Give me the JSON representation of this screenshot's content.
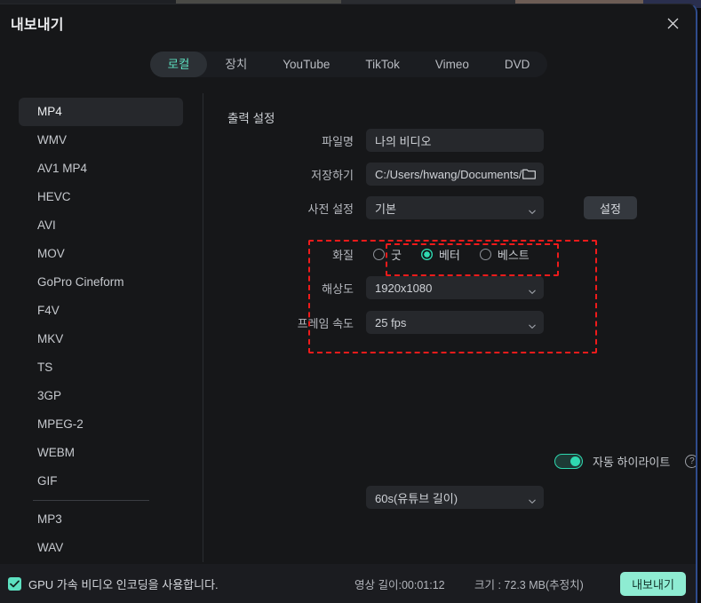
{
  "window": {
    "title": "내보내기",
    "close_icon": "close-icon",
    "accent": "#2fd9b0",
    "highlight_color": "#ef1b1b"
  },
  "tabs": [
    {
      "label": "로컬",
      "active": true
    },
    {
      "label": "장치",
      "active": false
    },
    {
      "label": "YouTube",
      "active": false
    },
    {
      "label": "TikTok",
      "active": false
    },
    {
      "label": "Vimeo",
      "active": false
    },
    {
      "label": "DVD",
      "active": false
    }
  ],
  "formats": [
    {
      "label": "MP4",
      "selected": true
    },
    {
      "label": "WMV",
      "selected": false
    },
    {
      "label": "AV1 MP4",
      "selected": false
    },
    {
      "label": "HEVC",
      "selected": false
    },
    {
      "label": "AVI",
      "selected": false
    },
    {
      "label": "MOV",
      "selected": false
    },
    {
      "label": "GoPro Cineform",
      "selected": false
    },
    {
      "label": "F4V",
      "selected": false
    },
    {
      "label": "MKV",
      "selected": false
    },
    {
      "label": "TS",
      "selected": false
    },
    {
      "label": "3GP",
      "selected": false
    },
    {
      "label": "MPEG-2",
      "selected": false
    },
    {
      "label": "WEBM",
      "selected": false
    },
    {
      "label": "GIF",
      "selected": false
    },
    {
      "label": "MP3",
      "selected": false,
      "divider_before": true
    },
    {
      "label": "WAV",
      "selected": false
    }
  ],
  "output": {
    "section_title": "출력 설정",
    "filename": {
      "label": "파일명",
      "value": "나의 비디오"
    },
    "save_to": {
      "label": "저장하기",
      "value": "C:/Users/hwang/Documents/",
      "browse_icon": "folder-icon"
    },
    "preset": {
      "label": "사전 설정",
      "value": "기본",
      "settings_button": "설정"
    },
    "quality": {
      "label": "화질",
      "options": [
        {
          "label": "굿",
          "checked": false
        },
        {
          "label": "베터",
          "checked": true
        },
        {
          "label": "베스트",
          "checked": false
        }
      ]
    },
    "resolution": {
      "label": "해상도",
      "value": "1920x1080"
    },
    "framerate": {
      "label": "프레임 속도",
      "value": "25 fps"
    }
  },
  "auto_highlight": {
    "label": "자동 하이라이트",
    "enabled": true,
    "help_icon": "question-mark-icon",
    "help_glyph": "?",
    "duration": "60s(유튜브 길이)"
  },
  "footer": {
    "gpu_label": "GPU 가속 비디오 인코딩을 사용합니다.",
    "gpu_checked": true,
    "check_glyph": "✓",
    "duration": "영상 길이:00:01:12",
    "size": "크기 : 72.3 MB(추정치)",
    "export_button": "내보내기"
  }
}
